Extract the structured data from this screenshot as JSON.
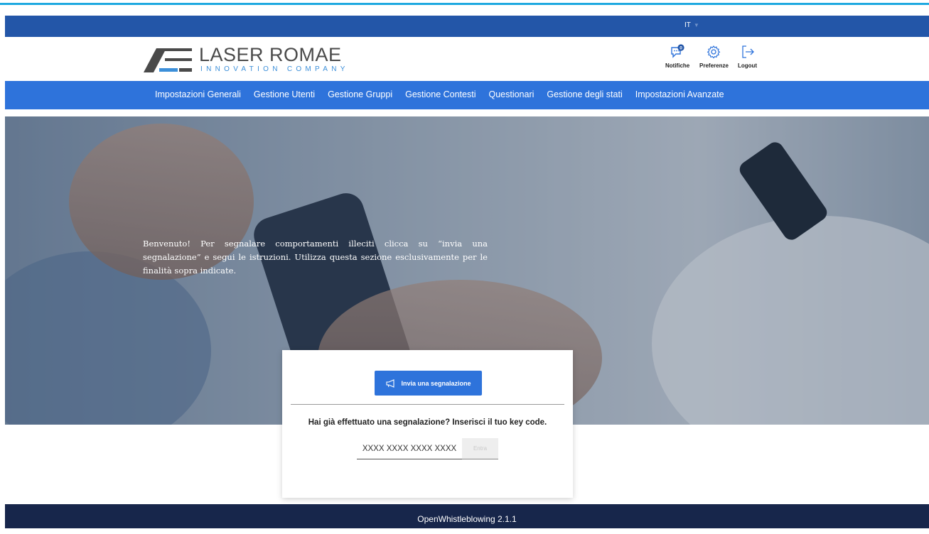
{
  "colors": {
    "accent_line": "#1fa9e0",
    "topbar": "#2356a8",
    "nav": "#2e73db",
    "primary_button": "#2e73db",
    "footer": "#17264b",
    "logo_accent": "#3c8fd9"
  },
  "topbar": {
    "language": "IT"
  },
  "logo": {
    "title": "LASER ROMAE",
    "subtitle": "INNOVATION COMPANY"
  },
  "header_actions": {
    "notifications": {
      "label": "Notifiche",
      "icon": "chat-bubble-icon",
      "badge": "0"
    },
    "preferences": {
      "label": "Preferenze",
      "icon": "gear-icon"
    },
    "logout": {
      "label": "Logout",
      "icon": "logout-arrow-icon"
    }
  },
  "nav": {
    "items": [
      {
        "label": "Impostazioni Generali"
      },
      {
        "label": "Gestione Utenti"
      },
      {
        "label": "Gestione Gruppi"
      },
      {
        "label": "Gestione Contesti"
      },
      {
        "label": "Questionari"
      },
      {
        "label": "Gestione degli stati"
      },
      {
        "label": "Impostazioni Avanzate"
      }
    ]
  },
  "hero": {
    "text": "Benvenuto! Per segnalare comportamenti illeciti clicca su “invia una segnalazione” e segui le istruzioni. Utilizza questa sezione esclusivamente per le finalità sopra indicate."
  },
  "card": {
    "send_button": "Invia una segnalazione",
    "send_icon": "megaphone-icon",
    "question": "Hai già effettuato una segnalazione? Inserisci il tuo key code.",
    "keycode_placeholder": "XXXX XXXX XXXX XXXX",
    "enter_button": "Entra"
  },
  "footer": {
    "text": "OpenWhistleblowing 2.1.1"
  }
}
